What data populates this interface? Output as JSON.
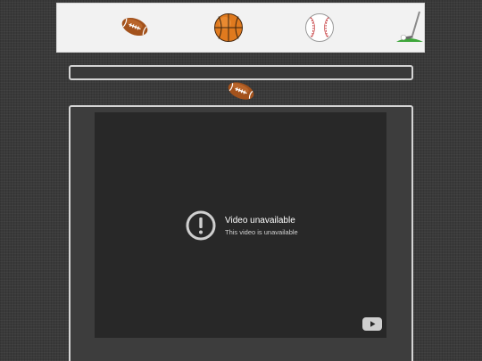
{
  "sports_nav": {
    "items": [
      {
        "name": "football",
        "icon": "football-icon"
      },
      {
        "name": "basketball",
        "icon": "basketball-icon"
      },
      {
        "name": "baseball",
        "icon": "baseball-icon"
      },
      {
        "name": "golf",
        "icon": "golf-icon"
      }
    ]
  },
  "video": {
    "error_title": "Video unavailable",
    "error_subtitle": "This video is unavailable"
  },
  "colors": {
    "background": "#3a3a3a",
    "nav_background": "#f2f2f2",
    "player_background": "#282828",
    "panel_border": "#d4d4d4"
  }
}
